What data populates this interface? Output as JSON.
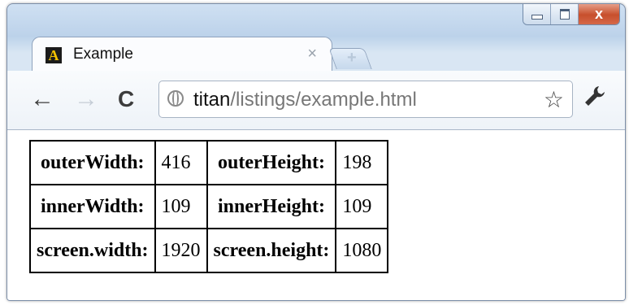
{
  "window": {
    "tab_title": "Example",
    "tab_close_glyph": "×",
    "new_tab_glyph": "+",
    "close_glyph": "x"
  },
  "toolbar": {
    "back_glyph": "←",
    "forward_glyph": "→",
    "reload_glyph": "C",
    "url_host": "titan",
    "url_path": "/listings/example.html",
    "star_glyph": "☆",
    "wrench_glyph": "🔧"
  },
  "icons": {
    "favicon": "letter-a-favicon",
    "globe": "globe-icon",
    "star": "star-icon",
    "wrench": "wrench-icon"
  },
  "table": {
    "rows": [
      {
        "label1": "outerWidth:",
        "value1": "416",
        "label2": "outerHeight:",
        "value2": "198"
      },
      {
        "label1": "innerWidth:",
        "value1": "109",
        "label2": "innerHeight:",
        "value2": "109"
      },
      {
        "label1": "screen.width:",
        "value1": "1920",
        "label2": "screen.height:",
        "value2": "1080"
      }
    ]
  },
  "colors": {
    "close_button": "#c74f2c",
    "favicon_bg": "#1b1b1b",
    "favicon_letter": "#f2c200"
  }
}
